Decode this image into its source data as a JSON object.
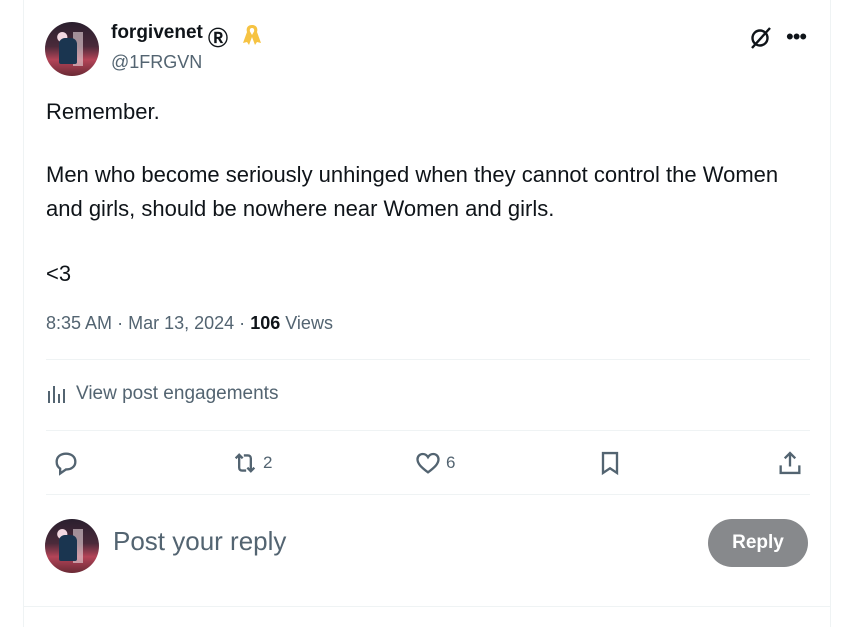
{
  "post": {
    "author_name": "forgivenet",
    "author_badge": "Ⓡ",
    "ribbon_icon": "ribbon-icon",
    "handle": "@1FRGVN",
    "paragraphs": [
      "Remember.",
      "Men who become seriously unhinged when they cannot control the Women and girls, should be nowhere near Women and girls.",
      "<3"
    ],
    "time": "8:35 AM",
    "date": "Mar 13, 2024",
    "views_count": "106",
    "views_label": "Views",
    "separator": "·"
  },
  "engagements_label": "View post engagements",
  "actions": {
    "reply_count": "",
    "repost_count": "2",
    "like_count": "6"
  },
  "composer": {
    "placeholder": "Post your reply",
    "reply_button": "Reply"
  },
  "colors": {
    "text": "#0f1419",
    "secondary": "#536471",
    "divider": "#eff3f4",
    "reply_button_bg": "#87898c",
    "ribbon": "#f6c343"
  }
}
